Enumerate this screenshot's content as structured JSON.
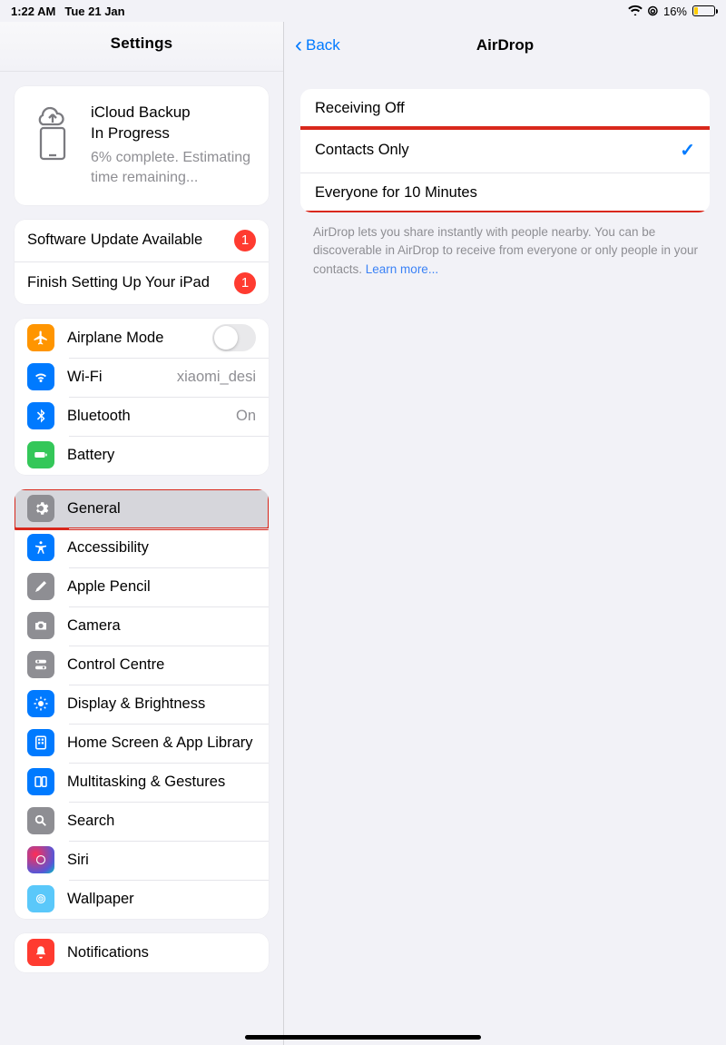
{
  "status": {
    "time": "1:22 AM",
    "date": "Tue 21 Jan",
    "battery_pct": "16%"
  },
  "sidebar": {
    "title": "Settings",
    "backup": {
      "title1": "iCloud Backup",
      "title2": "In Progress",
      "sub": "6% complete. Estimating time remaining..."
    },
    "alerts": [
      {
        "label": "Software Update Available",
        "badge": "1"
      },
      {
        "label": "Finish Setting Up Your iPad",
        "badge": "1"
      }
    ],
    "group_conn": {
      "airplane": "Airplane Mode",
      "wifi": "Wi-Fi",
      "wifi_val": "xiaomi_desi",
      "bt": "Bluetooth",
      "bt_val": "On",
      "battery": "Battery"
    },
    "group_main": {
      "general": "General",
      "accessibility": "Accessibility",
      "pencil": "Apple Pencil",
      "camera": "Camera",
      "control": "Control Centre",
      "display": "Display & Brightness",
      "home": "Home Screen & App Library",
      "multitask": "Multitasking & Gestures",
      "search": "Search",
      "siri": "Siri",
      "wallpaper": "Wallpaper"
    },
    "group_notif": {
      "notifications": "Notifications"
    }
  },
  "detail": {
    "back": "Back",
    "title": "AirDrop",
    "options": {
      "off": "Receiving Off",
      "contacts": "Contacts Only",
      "contacts_selected": true,
      "everyone": "Everyone for 10 Minutes"
    },
    "footer": "AirDrop lets you share instantly with people nearby. You can be discoverable in AirDrop to receive from everyone or only people in your contacts. ",
    "learn_more": "Learn more..."
  }
}
